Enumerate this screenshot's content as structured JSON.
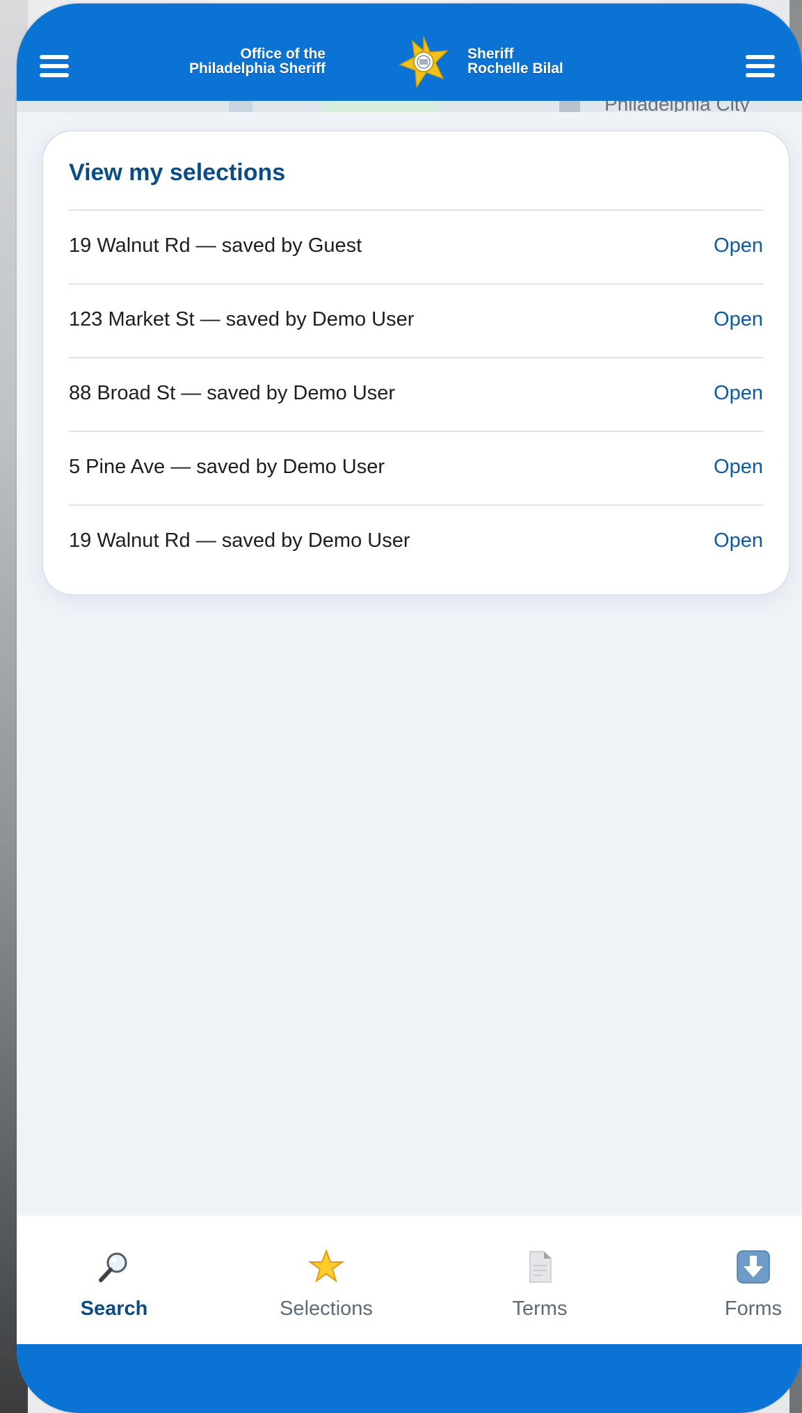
{
  "header": {
    "brand_left_line1": "Office of the",
    "brand_left_line2": "Philadelphia Sheriff",
    "brand_right_line1": "Sheriff",
    "brand_right_line2": "Rochelle Bilal"
  },
  "map_label": "Philadelphia City",
  "selections": {
    "title": "View my selections",
    "items": [
      {
        "label": "19 Walnut Rd — saved by Guest",
        "action": "Open"
      },
      {
        "label": "123 Market St — saved by Demo User",
        "action": "Open"
      },
      {
        "label": "88 Broad St — saved by Demo User",
        "action": "Open"
      },
      {
        "label": "5 Pine Ave — saved by Demo User",
        "action": "Open"
      },
      {
        "label": "19 Walnut Rd — saved by Demo User",
        "action": "Open"
      }
    ]
  },
  "tabs": [
    {
      "label": "Search",
      "icon": "magnifier-icon",
      "active": true
    },
    {
      "label": "Selections",
      "icon": "star-icon",
      "active": false
    },
    {
      "label": "Terms",
      "icon": "document-icon",
      "active": false
    },
    {
      "label": "Forms",
      "icon": "download-icon",
      "active": false
    }
  ],
  "colors": {
    "brand_blue": "#0a73d3",
    "title_blue": "#0c4c84",
    "link_blue": "#0e5aa2",
    "page_bg": "#eff3f8"
  }
}
